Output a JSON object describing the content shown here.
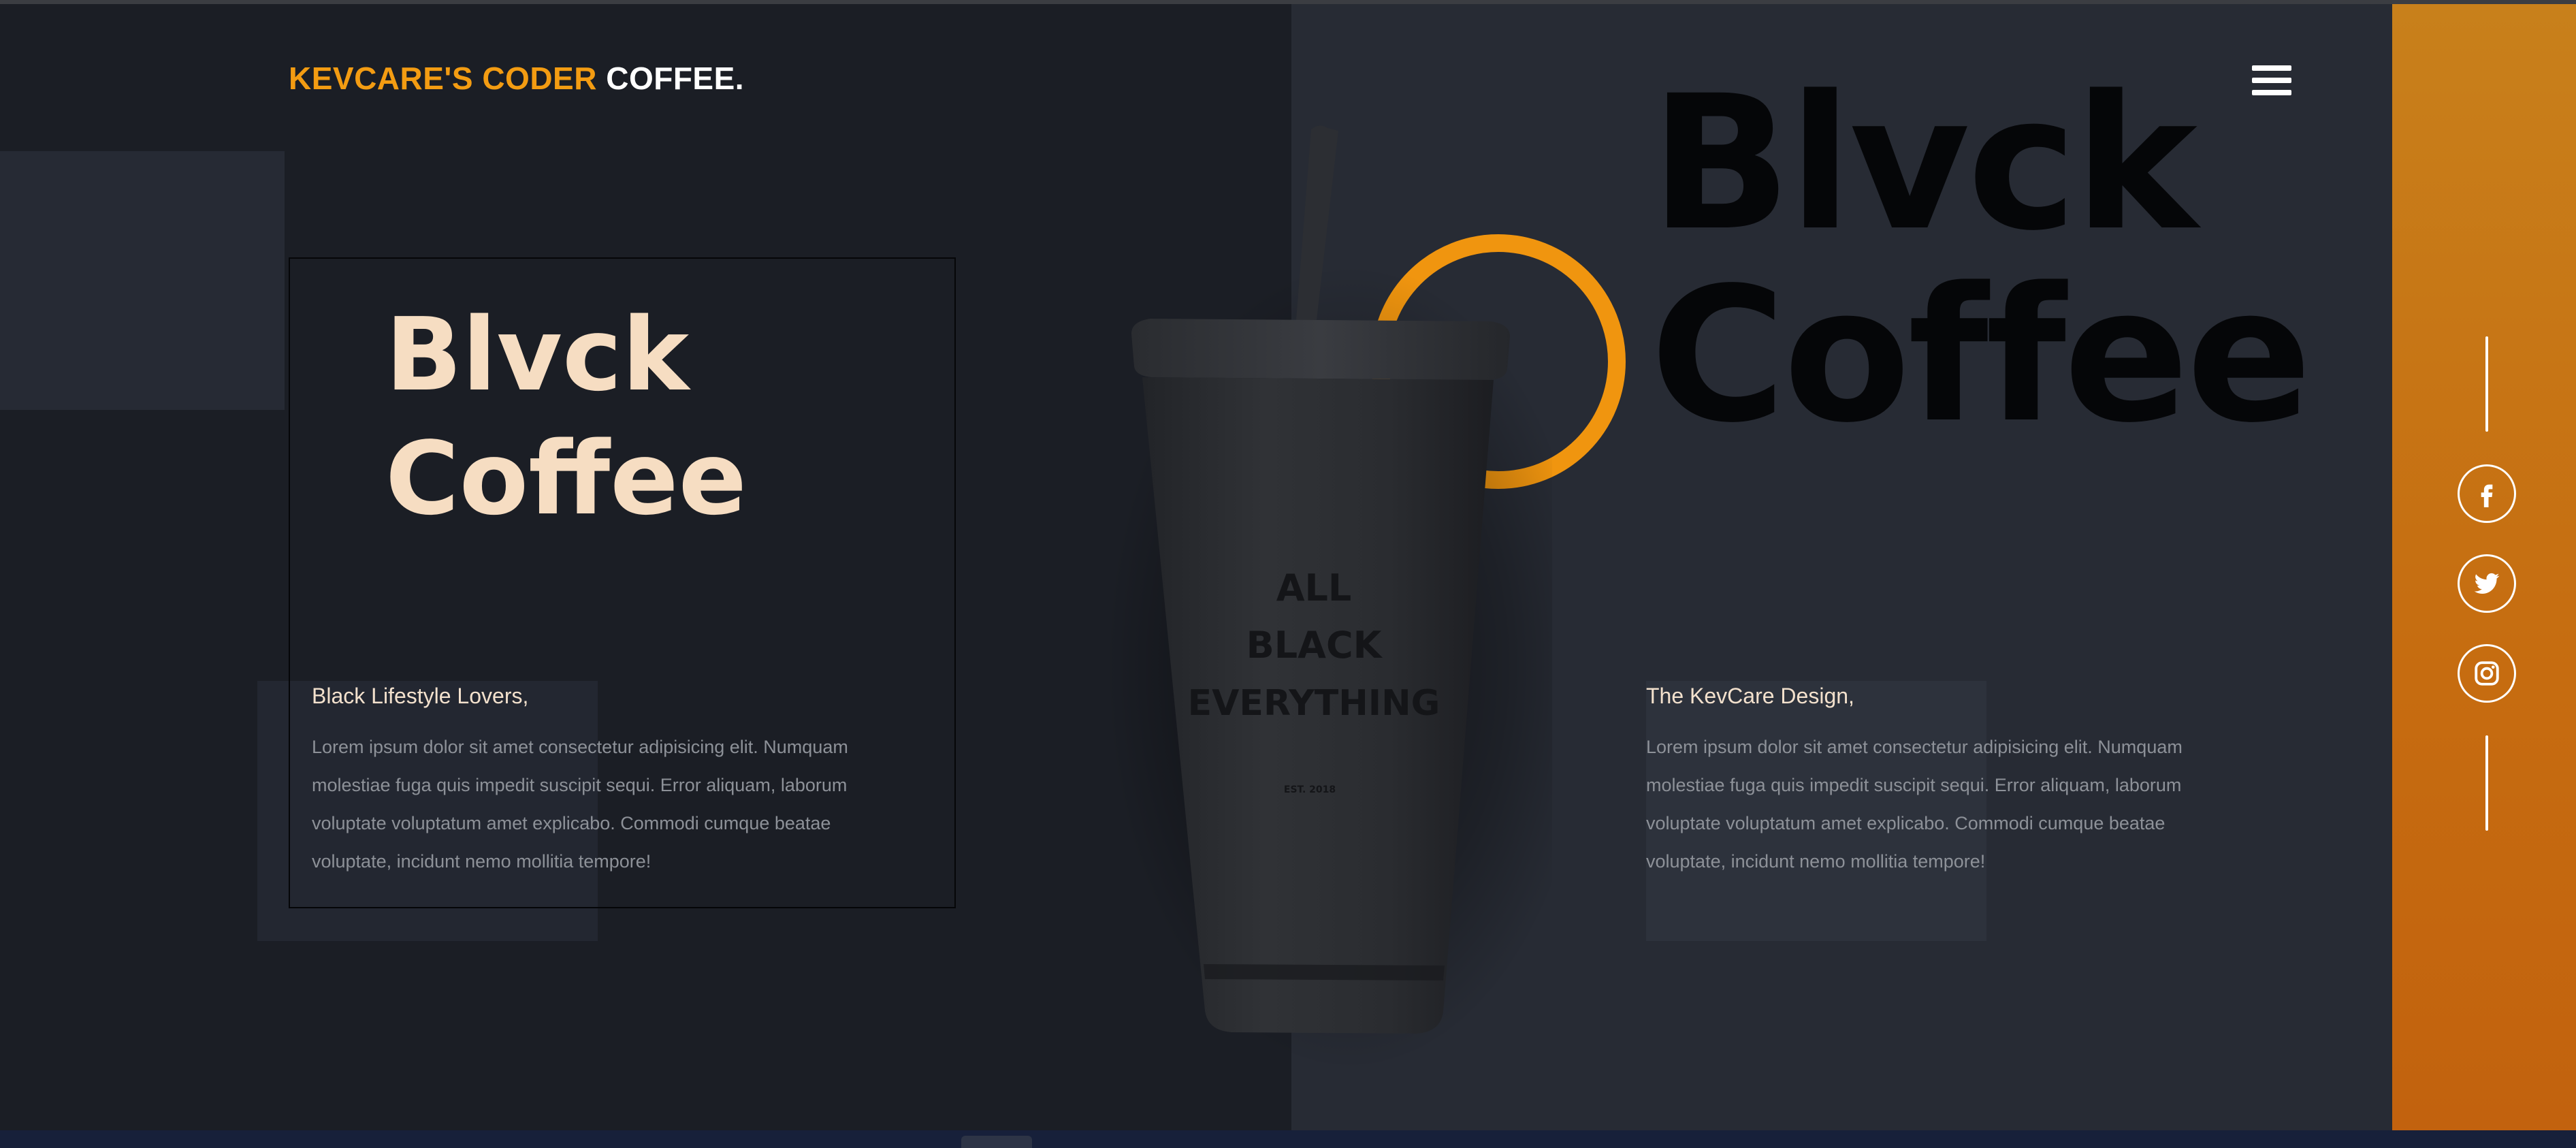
{
  "brand": {
    "accent_text": "KEVCARE'S CODER",
    "light_text": "COFFEE."
  },
  "hero": {
    "title_line1": "Blvck",
    "title_line2": "Coffee"
  },
  "big_title": {
    "line1": "Blvck",
    "line2": "Coffee"
  },
  "left_block": {
    "heading": "Black Lifestyle Lovers,",
    "body": "Lorem ipsum dolor sit amet consectetur adipisicing elit. Numquam molestiae fuga quis impedit suscipit sequi. Error aliquam, laborum voluptate voluptatum amet explicabo. Commodi cumque beatae voluptate, incidunt nemo mollitia tempore!"
  },
  "right_block": {
    "heading": "The KevCare Design,",
    "body": "Lorem ipsum dolor sit amet consectetur adipisicing elit. Numquam molestiae fuga quis impedit suscipit sequi. Error aliquam, laborum voluptate voluptatum amet explicabo. Commodi cumque beatae voluptate, incidunt nemo mollitia tempore!"
  },
  "cup": {
    "line1": "ALL",
    "line2": "BLACK",
    "line3": "EVERYTHING",
    "est": "EST. 2018"
  },
  "menu": {
    "icon": "hamburger-menu-icon"
  },
  "social": [
    {
      "name": "facebook",
      "icon": "facebook-icon"
    },
    {
      "name": "twitter",
      "icon": "twitter-icon"
    },
    {
      "name": "instagram",
      "icon": "instagram-icon"
    }
  ],
  "colors": {
    "accent_orange": "#f39c12",
    "sidebar_orange": "#c66c10",
    "left_bg": "#1b1e25",
    "right_bg": "#272b34",
    "hero_title": "#f6ddc2",
    "big_title": "#050608"
  }
}
